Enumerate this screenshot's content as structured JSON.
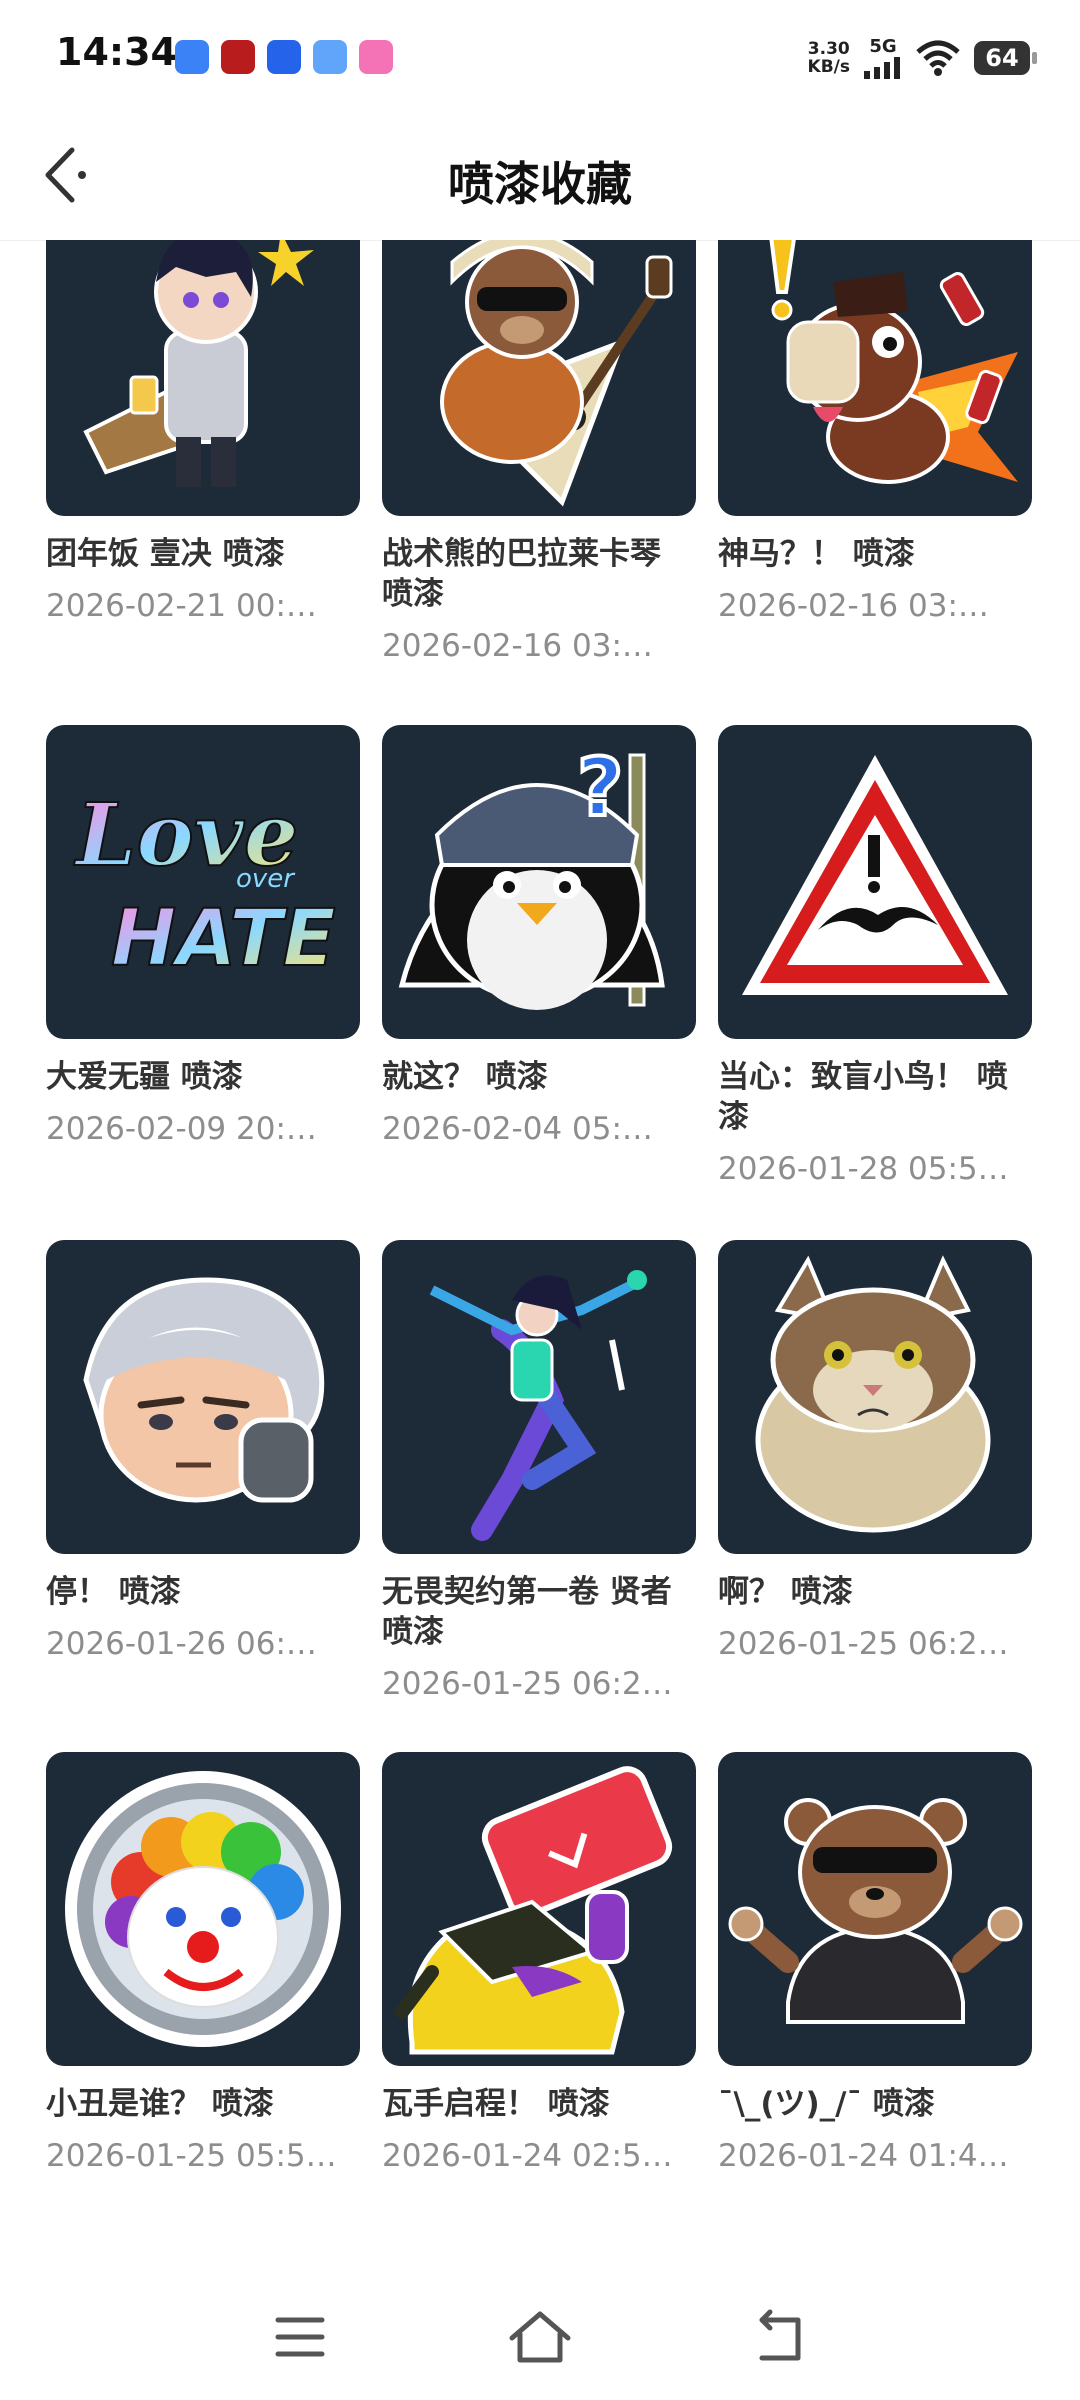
{
  "status_bar": {
    "time": "14:34",
    "net_speed_value": "3.30",
    "net_speed_unit": "KB/s",
    "network": "5G",
    "battery": "64"
  },
  "header": {
    "title": "喷漆收藏"
  },
  "items": [
    {
      "name": "团年饭 壹决 喷漆",
      "date": "2026-02-21 00:…"
    },
    {
      "name": "战术熊的巴拉莱卡琴 喷漆",
      "date": "2026-02-16 03:…"
    },
    {
      "name": "神马？！ 喷漆",
      "date": "2026-02-16 03:…"
    },
    {
      "name": "大爱无疆 喷漆",
      "date": "2026-02-09 20:…"
    },
    {
      "name": "就这？ 喷漆",
      "date": "2026-02-04 05:…"
    },
    {
      "name": "当心：致盲小鸟！ 喷漆",
      "date": "2026-01-28 05:5…"
    },
    {
      "name": "停！ 喷漆",
      "date": "2026-01-26 06:…"
    },
    {
      "name": "无畏契约第一卷 贤者 喷漆",
      "date": "2026-01-25 06:2…"
    },
    {
      "name": "啊？ 喷漆",
      "date": "2026-01-25 06:2…"
    },
    {
      "name": "小丑是谁？ 喷漆",
      "date": "2026-01-25 05:5…"
    },
    {
      "name": "瓦手启程！ 喷漆",
      "date": "2026-01-24 02:5…"
    },
    {
      "name": "¯\\_(ツ)_/¯ 喷漆",
      "date": "2026-01-24 01:4…"
    }
  ],
  "sticker_text": {
    "love": "Love",
    "over": "over",
    "hate": "HATE"
  },
  "colors": {
    "tile_bg": "#1d2a38",
    "title": "#111111",
    "name": "#333333",
    "date": "#8d8d8d"
  }
}
